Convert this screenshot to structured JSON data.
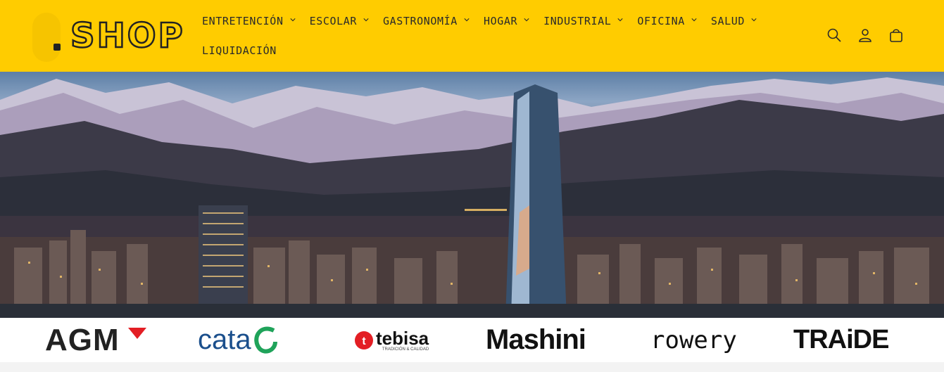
{
  "header": {
    "logo_text": "SHOP",
    "background": "#ffcc00",
    "nav_row1": [
      "ENTRETENCIÓN",
      "ESCOLAR",
      "GASTRONOMÍA",
      "HOGAR",
      "INDUSTRIAL",
      "OFICINA",
      "SALUD"
    ],
    "nav_row2": [
      "LIQUIDACIÓN"
    ],
    "icons": [
      "search-icon",
      "account-icon",
      "cart-icon"
    ]
  },
  "hero": {
    "subject": "city-skyline-mountains"
  },
  "brands": [
    "AGM",
    "cata",
    "tebisa",
    "TRADICIÓN & CALIDAD",
    "Mashini",
    "rowery",
    "TRAiDE"
  ]
}
